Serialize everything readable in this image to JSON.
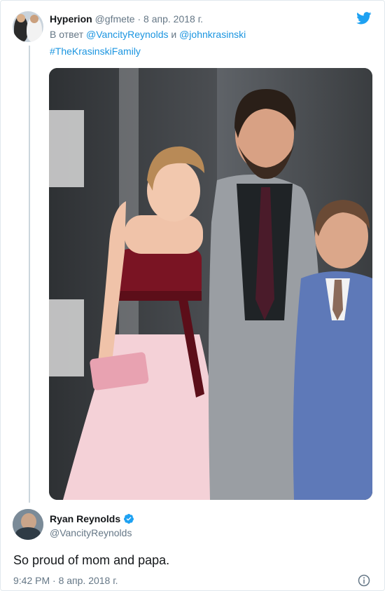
{
  "reply_tweet": {
    "author_name": "Hyperion",
    "author_handle": "@gfmete",
    "separator": "·",
    "date": "8 апр. 2018 г.",
    "reply_prefix": "В ответ",
    "reply_to_1": "@VancityReynolds",
    "reply_and": "и",
    "reply_to_2": "@johnkrasinski",
    "hashtag": "#TheKrasinskiFamily"
  },
  "main_tweet": {
    "author_name": "Ryan Reynolds",
    "author_handle": "@VancityReynolds",
    "text": "So proud of mom and papa.",
    "timestamp": "9:42 PM · 8 апр. 2018 г."
  },
  "icons": {
    "brand": "twitter-bird-icon",
    "verified": "verified-badge-icon",
    "info": "info-icon"
  },
  "colors": {
    "link": "#1b95e0",
    "muted": "#657786",
    "text": "#14171a",
    "verified": "#1da1f2"
  }
}
